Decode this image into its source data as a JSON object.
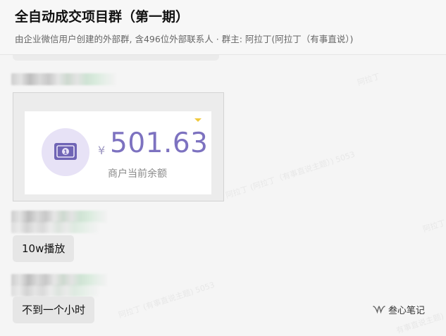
{
  "header": {
    "title": "全自动成交项目群（第一期）",
    "subtitle": "由企业微信用户创建的外部群, 含496位外部联系人 · 群主: 阿拉丁(阿拉丁（有事直说）)"
  },
  "messages": {
    "card": {
      "currency": "¥",
      "amount": "501.63",
      "label": "商户当前余额"
    },
    "bubble_1": "10w播放",
    "bubble_2": "不到一个小时"
  },
  "watermark": {
    "lines": [
      "阿拉丁",
      "阿拉丁 (阿拉丁（有事直说主题）) 5053",
      "阿拉丁 (有事直说主题) 5053",
      "阿拉丁（有事直说主题）) 5053",
      "有事直说主题)"
    ]
  },
  "brand": {
    "label": "叁心笔记",
    "icon": "wechat-channel-icon"
  },
  "colors": {
    "amount": "#7d72c0",
    "wallet_bg": "#e7e2f6",
    "wallet_icon": "#6f64b5",
    "bubble_bg": "#e6e6e6"
  }
}
